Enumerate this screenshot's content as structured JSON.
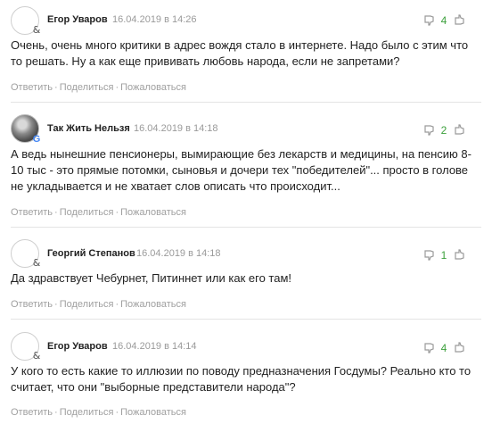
{
  "comments": [
    {
      "author": "Егор Уваров",
      "date": "16.04.2019 в 14:26",
      "likes": "4",
      "text": "Очень, очень много критики в адрес вождя стало в интернете. Надо было с этим что то решать. Ну а как еще прививать любовь народа, если не запретами?",
      "avatar": "avatar-placeholder",
      "provider_icon": "&"
    },
    {
      "author": "Так Жить Нельзя",
      "date": "16.04.2019 в 14:18",
      "likes": "2",
      "text": "А ведь нынешние пенсионеры, вымирающие без лекарств и медицины, на пенсию 8-10 тыс - это прямые потомки, сыновья и дочери тех \"победителей\"... просто в голове не укладывается и не хватает слов описать что происходит...",
      "avatar": "avatar-photo",
      "provider_icon": "G"
    },
    {
      "author": "Георгий Степанов",
      "date": "16.04.2019 в 14:18",
      "likes": "1",
      "text": "Да здравствует Чебурнет, Питиннет или как его там!",
      "avatar": "avatar-placeholder",
      "provider_icon": "&"
    },
    {
      "author": "Егор Уваров",
      "date": "16.04.2019 в 14:14",
      "likes": "4",
      "text": "У кого то есть какие то иллюзии по поводу предназначения Госдумы? Реально кто то считает, что они \"выборные представители народа\"?",
      "avatar": "avatar-placeholder",
      "provider_icon": "&"
    }
  ],
  "actions": {
    "reply": "Ответить",
    "share": "Поделиться",
    "report": "Пожаловаться",
    "separator": "·"
  },
  "icons": {
    "dislike": "thumb-down-icon",
    "like": "thumb-up-icon"
  },
  "colors": {
    "likes_count": "#3ca03c",
    "muted": "#9a9a9a",
    "text": "#222222",
    "divider": "#e4e4e4"
  }
}
